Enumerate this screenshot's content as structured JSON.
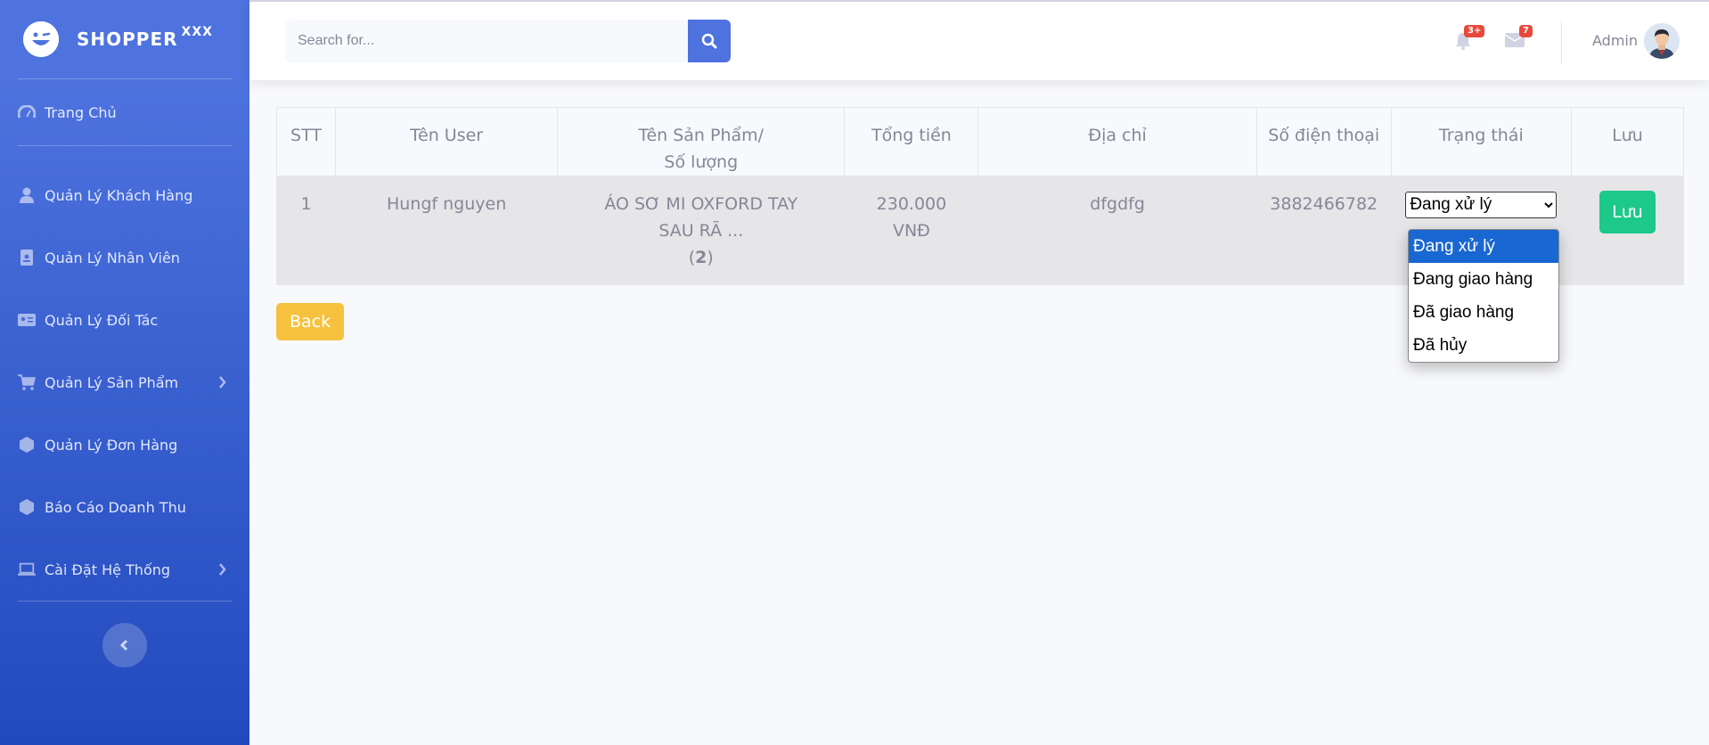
{
  "brand": {
    "name": "SHOPPER",
    "suffix": "XXX"
  },
  "sidebar": {
    "items": [
      {
        "label": "Trang Chủ",
        "icon": "dashboard-icon"
      },
      {
        "label": "Quản Lý Khách Hàng",
        "icon": "user-icon"
      },
      {
        "label": "Quản Lý Nhân Viên",
        "icon": "id-badge-icon"
      },
      {
        "label": "Quản Lý Đối Tác",
        "icon": "id-card-icon"
      },
      {
        "label": "Quản Lý Sản Phẩm",
        "icon": "cart-icon"
      },
      {
        "label": "Quản Lý Đơn Hàng",
        "icon": "hexagon-icon"
      },
      {
        "label": "Báo Cáo Doanh Thu",
        "icon": "hexagon-icon"
      },
      {
        "label": "Cài Đặt Hệ Thống",
        "icon": "laptop-icon"
      }
    ]
  },
  "topbar": {
    "search_placeholder": "Search for...",
    "alerts_badge": "3+",
    "messages_badge": "7",
    "user_name": "Admin"
  },
  "table": {
    "headers": [
      "STT",
      "Tên User",
      "Tên Sản Phẩm/",
      "Số lượng",
      "Tổng tiền",
      "Địa chỉ",
      "Số điện thoại",
      "Trạng thái",
      "Lưu"
    ],
    "row": {
      "stt": "1",
      "user": "Hungf nguyen",
      "product": "ÁO SƠ MI OXFORD TAY SAU RÃ ...",
      "qty_open": "(",
      "qty": "2",
      "qty_close": ")",
      "total_line1": "230.000",
      "total_line2": "VNĐ",
      "address": "dfgdfg",
      "phone": "3882466782",
      "status": "Đang xử lý",
      "save_label": "Lưu"
    }
  },
  "status_options": [
    "Đang xử lý",
    "Đang giao hàng",
    "Đã giao hàng",
    "Đã hủy"
  ],
  "back_label": "Back"
}
